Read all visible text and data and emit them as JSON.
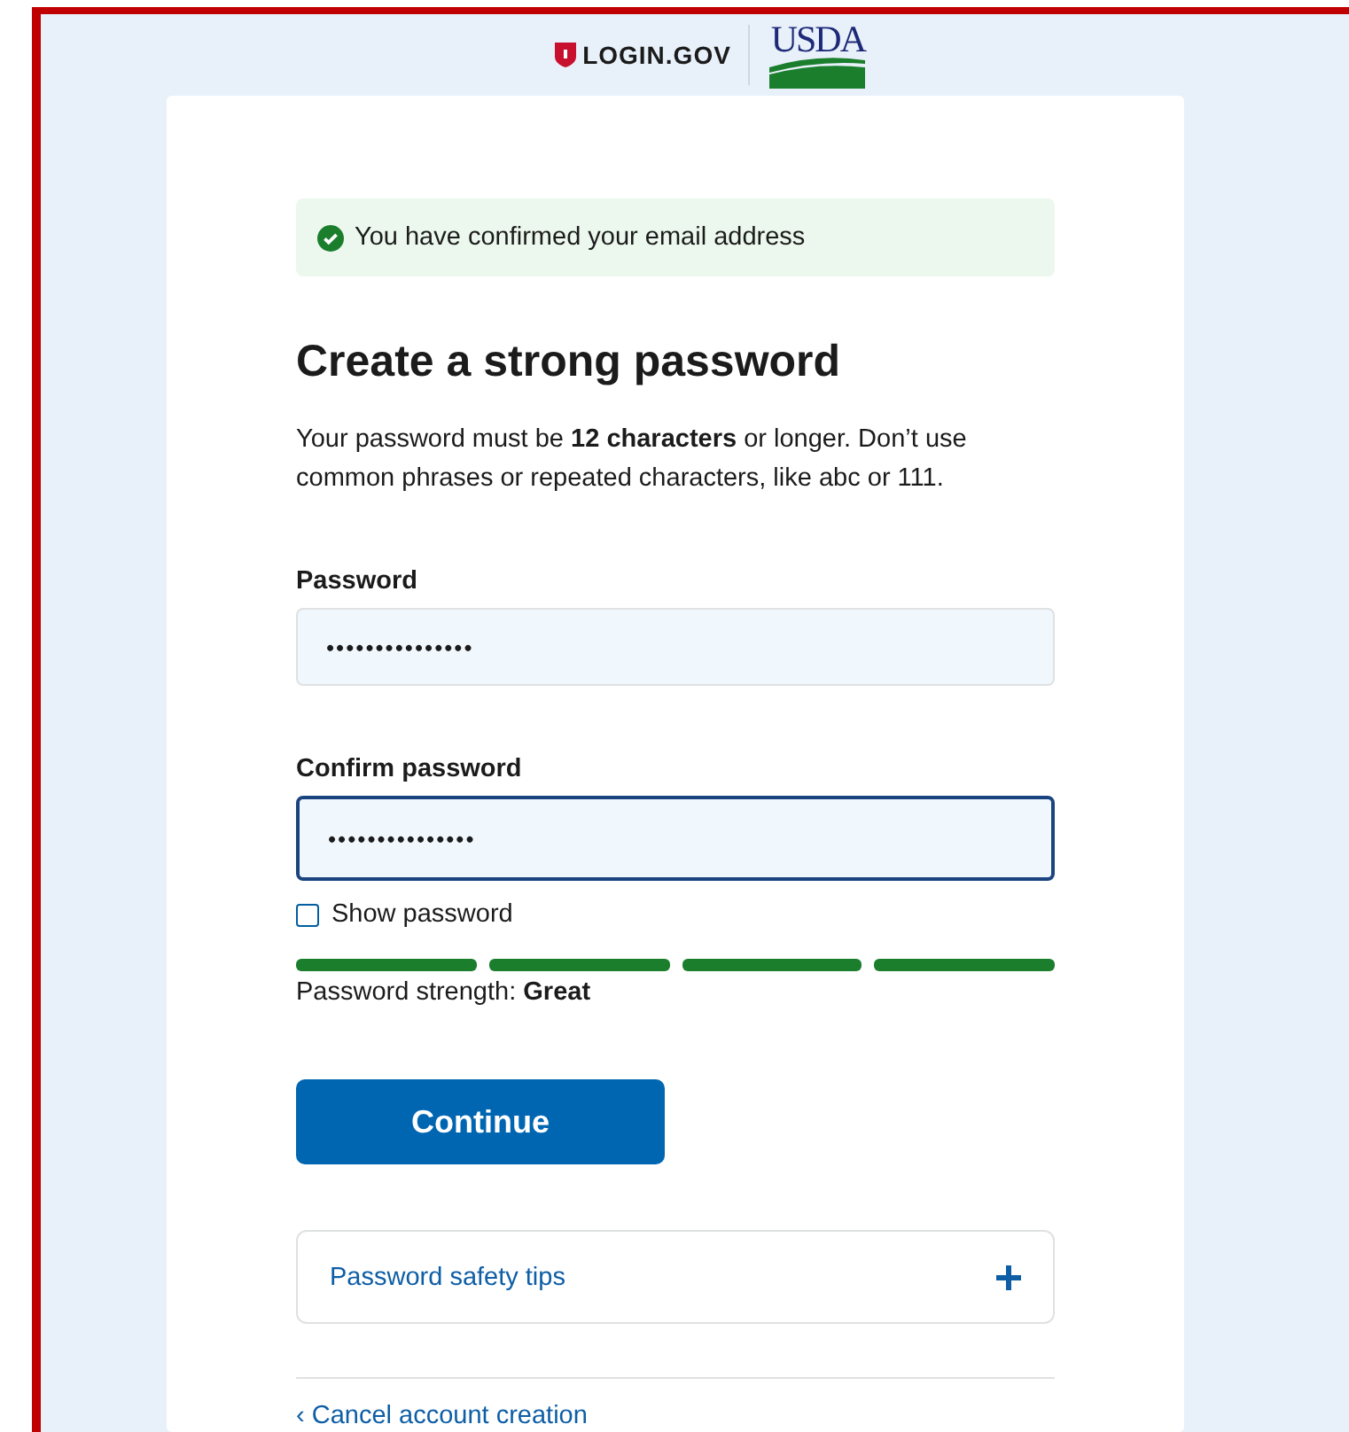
{
  "header": {
    "brand": "LOGIN.GOV",
    "partner": "USDA"
  },
  "alert": {
    "kind": "success",
    "text": "You have confirmed your email address"
  },
  "title": "Create a strong password",
  "intro": "Your password must be **12 characters** or longer. Don’t use common phrases or repeated characters, like abc or 111.",
  "fields": [
    {
      "label": "Password",
      "value": "•••••••••••••••",
      "focused": false
    },
    {
      "label": "Confirm password",
      "value": "•••••••••••••••",
      "focused": true
    }
  ],
  "show_password": {
    "label": "Show password",
    "checked": false
  },
  "strength": {
    "segments": [
      {
        "filled": true
      },
      {
        "filled": true
      },
      {
        "filled": true
      },
      {
        "filled": true
      }
    ],
    "label": "Password strength:",
    "value": "Great"
  },
  "continue_button": "Continue",
  "accordion": {
    "label": "Password safety tips",
    "expanded": false
  },
  "cancel_link": "‹ Cancel account creation"
}
